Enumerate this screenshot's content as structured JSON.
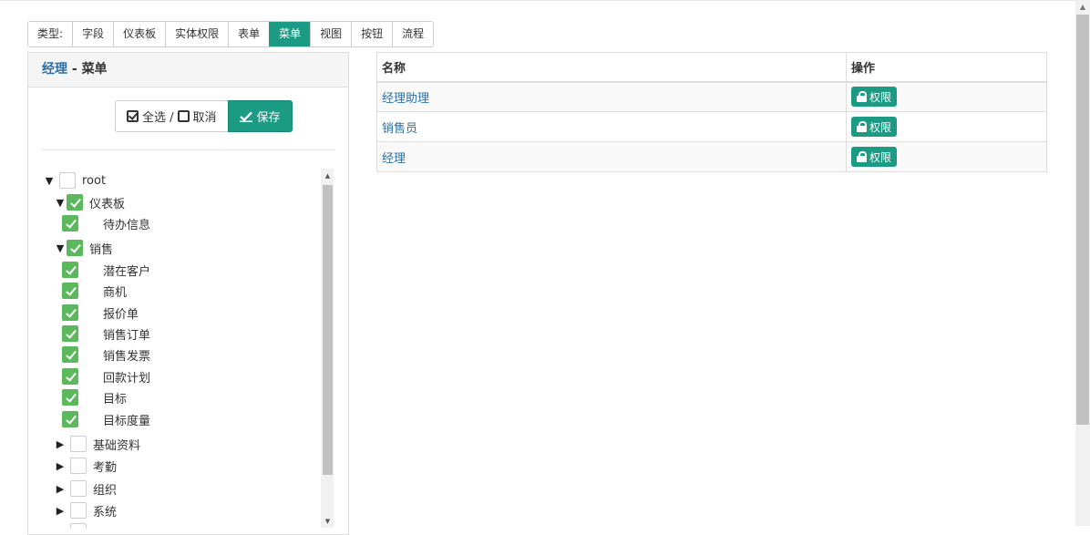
{
  "type_tabs": {
    "label": "类型:",
    "items": [
      "字段",
      "仪表板",
      "实体权限",
      "表单",
      "菜单",
      "视图",
      "按钮",
      "流程"
    ],
    "active": "菜单"
  },
  "left_panel": {
    "role_name": "经理",
    "separator": " - ",
    "title": "菜单",
    "select_all_label": "全选 /",
    "cancel_label": "取消",
    "save_label": "保存"
  },
  "tree": [
    {
      "label": "root",
      "checked": false,
      "toggle": "expanded"
    },
    {
      "label": "仪表板",
      "checked": true,
      "toggle": "expanded"
    },
    {
      "label": "待办信息",
      "checked": true,
      "toggle": ""
    },
    {
      "label": "销售",
      "checked": true,
      "toggle": "expanded"
    },
    {
      "label": "潜在客户",
      "checked": true,
      "toggle": ""
    },
    {
      "label": "商机",
      "checked": true,
      "toggle": ""
    },
    {
      "label": "报价单",
      "checked": true,
      "toggle": ""
    },
    {
      "label": "销售订单",
      "checked": true,
      "toggle": ""
    },
    {
      "label": "销售发票",
      "checked": true,
      "toggle": ""
    },
    {
      "label": "回款计划",
      "checked": true,
      "toggle": ""
    },
    {
      "label": "目标",
      "checked": true,
      "toggle": ""
    },
    {
      "label": "目标度量",
      "checked": true,
      "toggle": ""
    },
    {
      "label": "基础资料",
      "checked": false,
      "toggle": "collapsed"
    },
    {
      "label": "考勤",
      "checked": false,
      "toggle": "collapsed"
    },
    {
      "label": "组织",
      "checked": false,
      "toggle": "collapsed"
    },
    {
      "label": "系统",
      "checked": false,
      "toggle": "collapsed"
    }
  ],
  "roles_table": {
    "headers": [
      "名称",
      "操作"
    ],
    "rows": [
      {
        "name": "经理助理",
        "action": "权限"
      },
      {
        "name": "销售员",
        "action": "权限"
      },
      {
        "name": "经理",
        "action": "权限"
      }
    ]
  },
  "colors": {
    "accent": "#1b9a84",
    "checkbox_checked": "#5cb85c",
    "link": "#2a6fa8"
  }
}
